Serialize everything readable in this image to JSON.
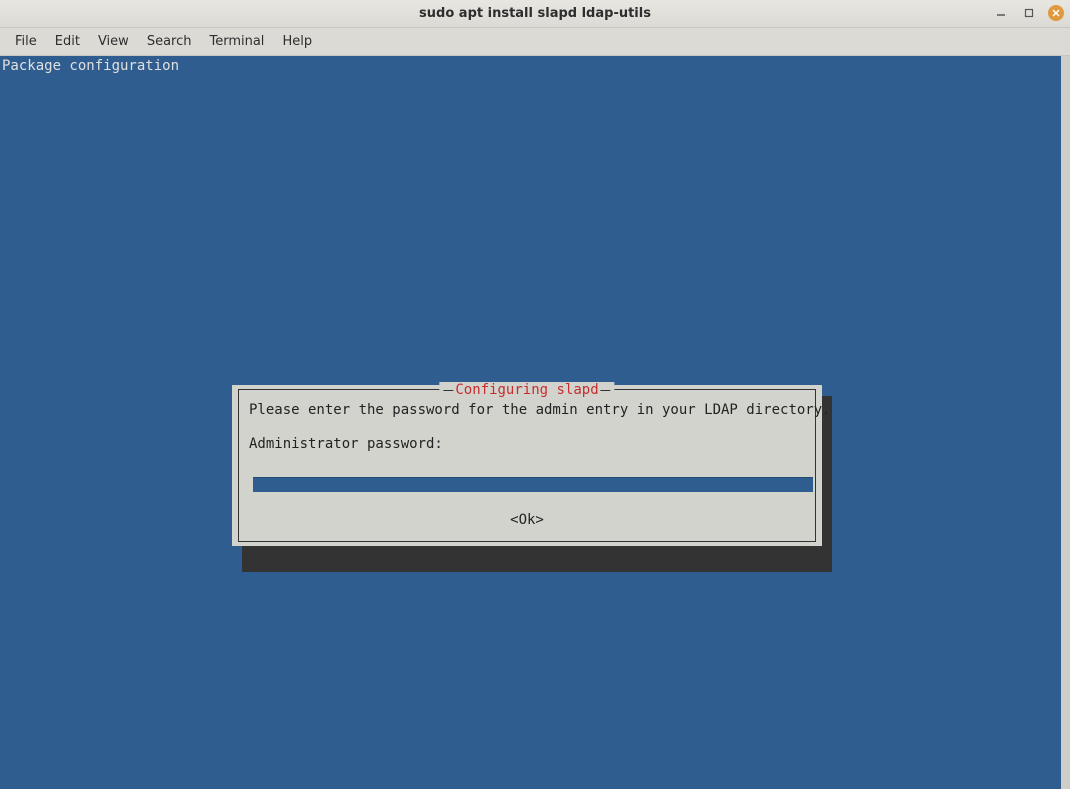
{
  "window": {
    "title": "sudo apt install slapd ldap-utils"
  },
  "menu": {
    "file": "File",
    "edit": "Edit",
    "view": "View",
    "search": "Search",
    "terminal": "Terminal",
    "help": "Help"
  },
  "terminal": {
    "header": "Package configuration"
  },
  "dialog": {
    "title": "Configuring slapd",
    "prompt": "Please enter the password for the admin entry in your LDAP directory.",
    "field_label": "Administrator password:",
    "password_value": "",
    "ok_label": "<Ok>"
  }
}
